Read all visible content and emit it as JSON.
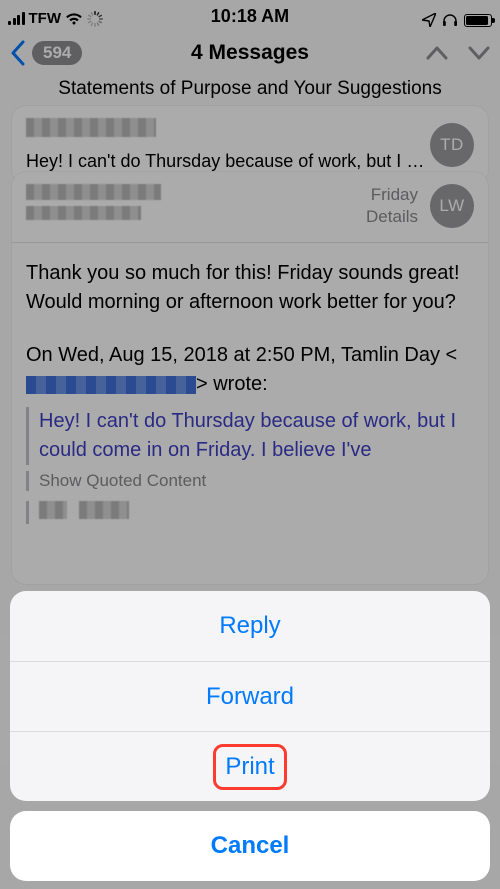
{
  "status": {
    "carrier": "TFW",
    "time": "10:18 AM"
  },
  "nav": {
    "back_count": "594",
    "title": "4 Messages",
    "subject": "Statements of Purpose and Your Suggestions"
  },
  "card1": {
    "preview": "Hey! I can't do Thursday because of work, but I co...",
    "avatar_initials": "TD"
  },
  "card2": {
    "timestamp": "Friday",
    "details_label": "Details",
    "avatar_initials": "LW",
    "body": "Thank you so much for this! Friday sounds great! Would morning or afternoon work better for you?",
    "quote_intro_prefix": "On Wed, Aug 15, 2018 at 2:50 PM, Tamlin Day <",
    "quote_intro_suffix": "> wrote:",
    "quoted_text": "Hey! I can't do Thursday because of work, but I could come in on Friday. I believe I've",
    "show_quoted_label": "Show Quoted Content"
  },
  "sheet": {
    "reply": "Reply",
    "forward": "Forward",
    "print": "Print",
    "cancel": "Cancel"
  }
}
